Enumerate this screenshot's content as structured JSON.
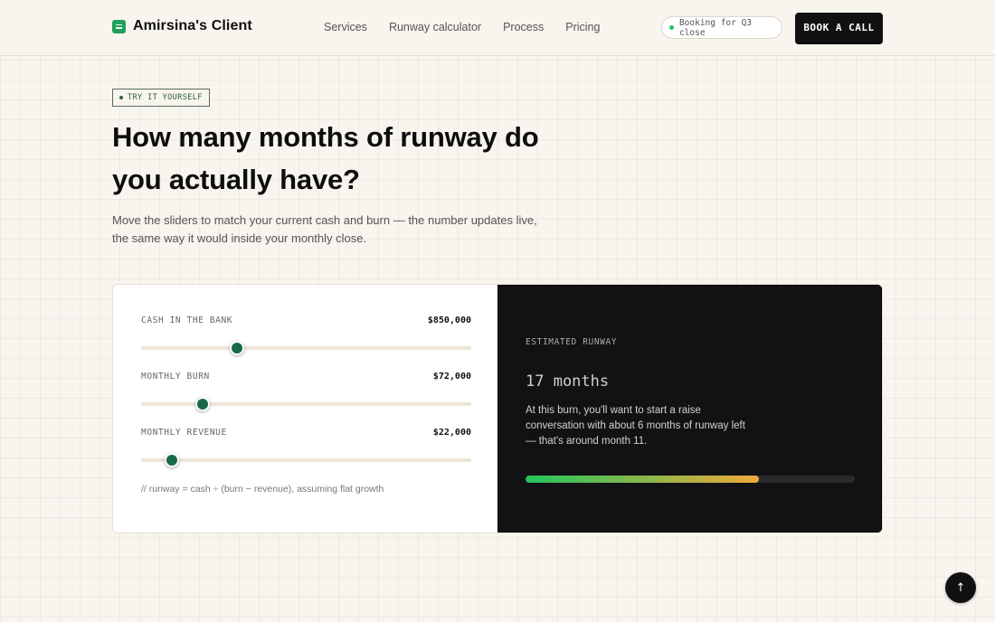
{
  "scroll_progress": 0.377,
  "header": {
    "brand_icon": "spreadsheet-icon",
    "brand_name": "Amirsina's Client",
    "nav": [
      "Services",
      "Runway calculator",
      "Process",
      "Pricing"
    ],
    "booking_status": "Booking for Q3 close",
    "cta_label": "BOOK A CALL"
  },
  "hero": {
    "eyebrow": "TRY IT YOURSELF",
    "title": "How many months of runway do you actually have?",
    "lede": "Move the sliders to match your current cash and burn — the number updates live, the same way it would inside your monthly close."
  },
  "calculator": {
    "sliders": [
      {
        "label": "CASH IN THE BANK",
        "value": "$850,000",
        "fraction": 0.29
      },
      {
        "label": "MONTHLY BURN",
        "value": "$72,000",
        "fraction": 0.185
      },
      {
        "label": "MONTHLY REVENUE",
        "value": "$22,000",
        "fraction": 0.093
      }
    ],
    "formula": "// runway = cash ÷ (burn − revenue), assuming flat growth",
    "result": {
      "label": "ESTIMATED RUNWAY",
      "value": "17 months",
      "description": "At this burn, you'll want to start a raise conversation with about 6 months of runway left — that's around month 11.",
      "bar_fraction": 0.71
    }
  },
  "colors": {
    "accent": "#17694a",
    "bar_start": "#22c55e",
    "bar_end": "#f0a83a",
    "dark_panel": "#121214"
  },
  "back_to_top_icon": "arrow-up-icon",
  "back_to_top_label": "↑"
}
